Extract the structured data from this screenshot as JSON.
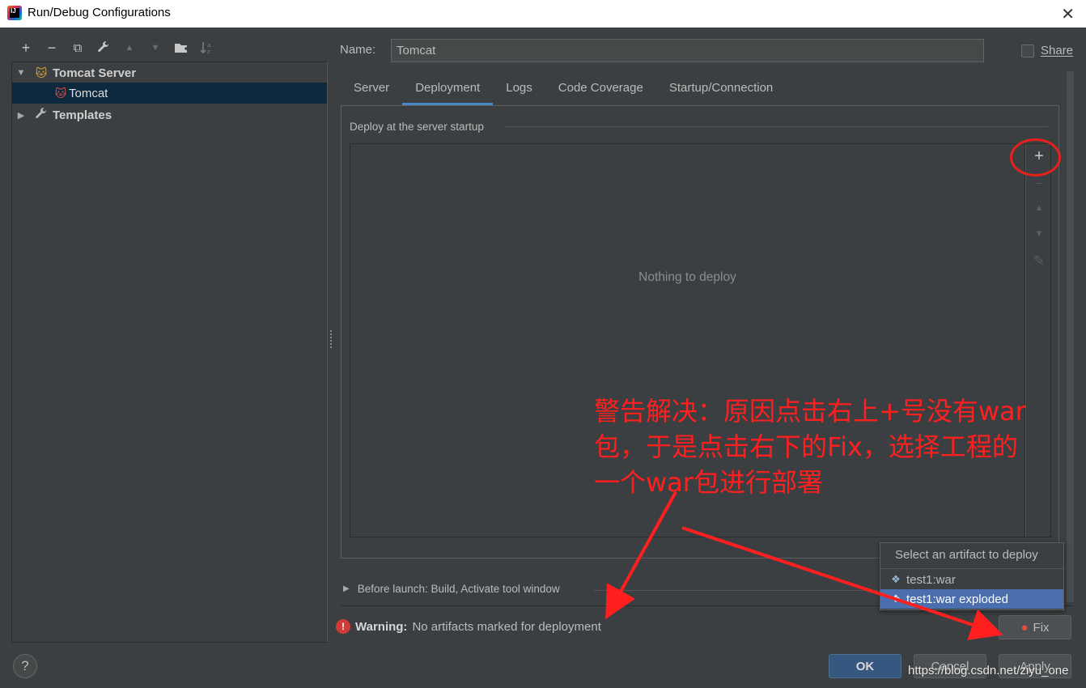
{
  "window": {
    "title": "Run/Debug Configurations",
    "close_glyph": "✕",
    "app_icon_text": "IJ"
  },
  "left_toolbar": {
    "add": "+",
    "remove": "−",
    "copy": "⧉",
    "edit_defaults": "🔧",
    "move_up": "▲",
    "move_down": "▼",
    "new_folder": "📁",
    "sort": "↓ᵃᶻ"
  },
  "tree": {
    "items": [
      {
        "label": "Tomcat Server",
        "expanded": true,
        "bold": true
      },
      {
        "label": "Tomcat",
        "selected": true
      },
      {
        "label": "Templates",
        "expanded": false,
        "bold": true
      }
    ]
  },
  "form": {
    "name_label": "Name:",
    "name_value": "Tomcat",
    "share_label": "Share",
    "share_checked": false
  },
  "tabs": [
    {
      "label": "Server"
    },
    {
      "label": "Deployment",
      "active": true
    },
    {
      "label": "Logs"
    },
    {
      "label": "Code Coverage"
    },
    {
      "label": "Startup/Connection"
    }
  ],
  "deployment": {
    "section_title": "Deploy at the server startup",
    "empty_text": "Nothing to deploy",
    "add": "+",
    "remove": "−",
    "up": "▲",
    "down": "▼",
    "edit": "✎"
  },
  "before_launch": {
    "label": "Before launch: Build, Activate tool window"
  },
  "warning": {
    "icon": "!",
    "bold": "Warning:",
    "text": "No artifacts marked for deployment"
  },
  "popup": {
    "title": "Select an artifact to deploy",
    "items": [
      {
        "label": "test1:war"
      },
      {
        "label": "test1:war exploded",
        "selected": true
      }
    ]
  },
  "buttons": {
    "fix": "Fix",
    "ok": "OK",
    "cancel": "Cancel",
    "apply": "Apply",
    "help": "?"
  },
  "annotation": {
    "lines": [
      "警告解决：原因点击右上+号没有war",
      "包，于是点击右下的Fix，选择工程的",
      "一个war包进行部署"
    ],
    "color": "#ff1f1f"
  },
  "watermark": "https://blog.csdn.net/ziyu_one",
  "colors": {
    "background": "#3c3f41",
    "selection": "#0d293e",
    "accent": "#4a88c7",
    "popup_selection": "#4b6eaf",
    "annotation": "#ff1f1f"
  }
}
